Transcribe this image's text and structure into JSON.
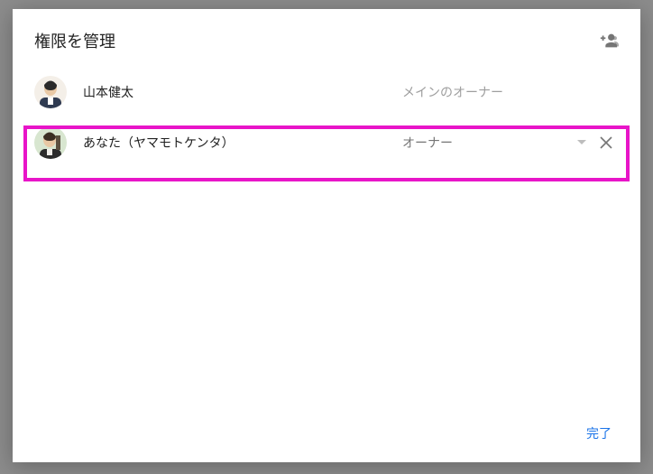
{
  "dialog": {
    "title": "権限を管理",
    "done_label": "完了"
  },
  "users": [
    {
      "name": "山本健太",
      "role": "メインのオーナー",
      "is_primary": true
    },
    {
      "name": "あなた（ヤマモトケンタ）",
      "role": "オーナー",
      "is_primary": false
    }
  ]
}
